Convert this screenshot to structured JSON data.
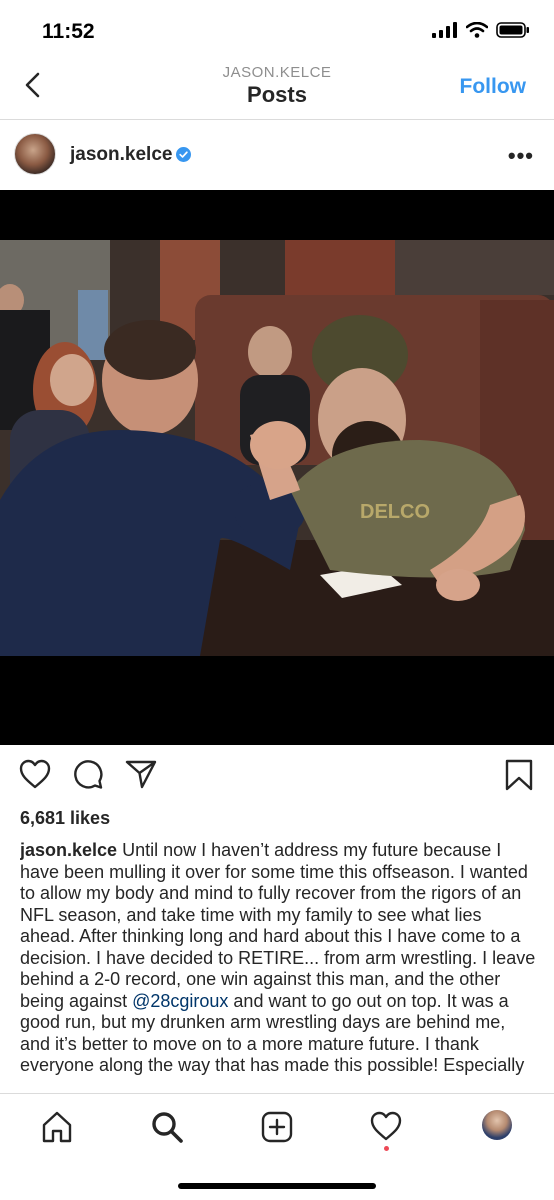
{
  "status": {
    "time": "11:52"
  },
  "nav": {
    "subtitle": "JASON.KELCE",
    "title": "Posts",
    "follow_label": "Follow"
  },
  "post": {
    "username": "jason.kelce",
    "likes": "6,681 likes",
    "caption_text": "Until now I haven’t address my future because I have been mulling it over for some time this offseason.  I wanted to allow my body and mind to fully recover from the rigors of an NFL season, and take time with my family to see what lies ahead.  After thinking long and hard about this I have come to a decision.  I have decided to RETIRE... from arm wrestling.  I leave behind a 2-0 record, one win against this man, and the other being against ",
    "caption_mention": "@28cgiroux",
    "caption_text_2": " and want to go out on top.  It was a good run, but my drunken arm wrestling days are behind me, and it’s better to move on to a more mature future.  I thank everyone along the way that has made this possible!  Especially",
    "shirt_text": "DELCO"
  },
  "icons": {
    "back": "chevron-left-icon",
    "verified": "verified-badge-icon",
    "more": "more-options-icon",
    "like": "heart-icon",
    "comment": "comment-icon",
    "share": "send-icon",
    "save": "bookmark-icon",
    "home": "home-icon",
    "search": "search-icon",
    "create": "plus-square-icon",
    "activity": "heart-icon",
    "profile": "profile-avatar"
  },
  "colors": {
    "accent": "#3897f0",
    "verified": "#3897f0",
    "notification": "#ed4956",
    "mention": "#003569"
  }
}
